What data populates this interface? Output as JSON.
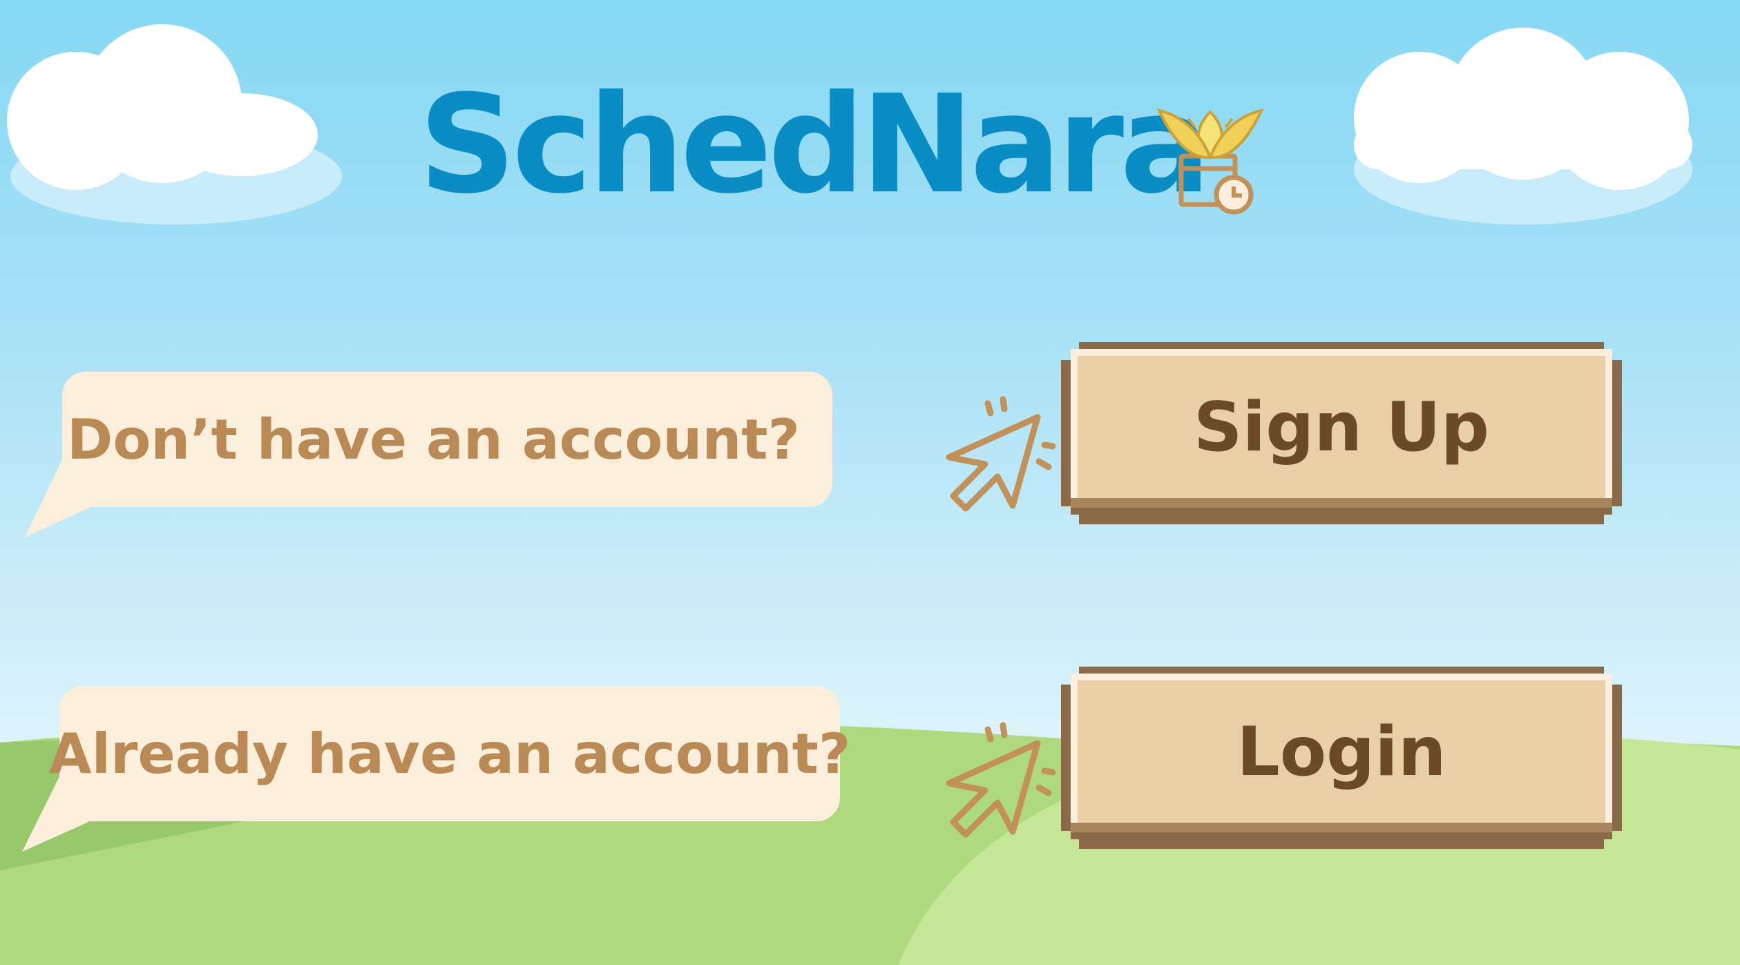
{
  "app": {
    "title": "SchedNara",
    "logo_icon": "lotus-calendar-icon"
  },
  "prompts": {
    "signup_question": "Don’t have an account?",
    "login_question": "Already have an account?"
  },
  "buttons": {
    "signup_label": "Sign Up",
    "login_label": "Login"
  },
  "icons": {
    "pointer": "click-cursor-icon"
  },
  "colors": {
    "sky_top": "#86d8f4",
    "title": "#0a8cc4",
    "bubble": "#fbeedb",
    "bubble_text": "#b98a55",
    "button_face": "#e8cfa6",
    "button_border": "#8b6a4a",
    "button_text": "#6b4a28",
    "cursor": "#c2915a",
    "hill_front": "#b3d984",
    "hill_back": "#c8e89a"
  }
}
